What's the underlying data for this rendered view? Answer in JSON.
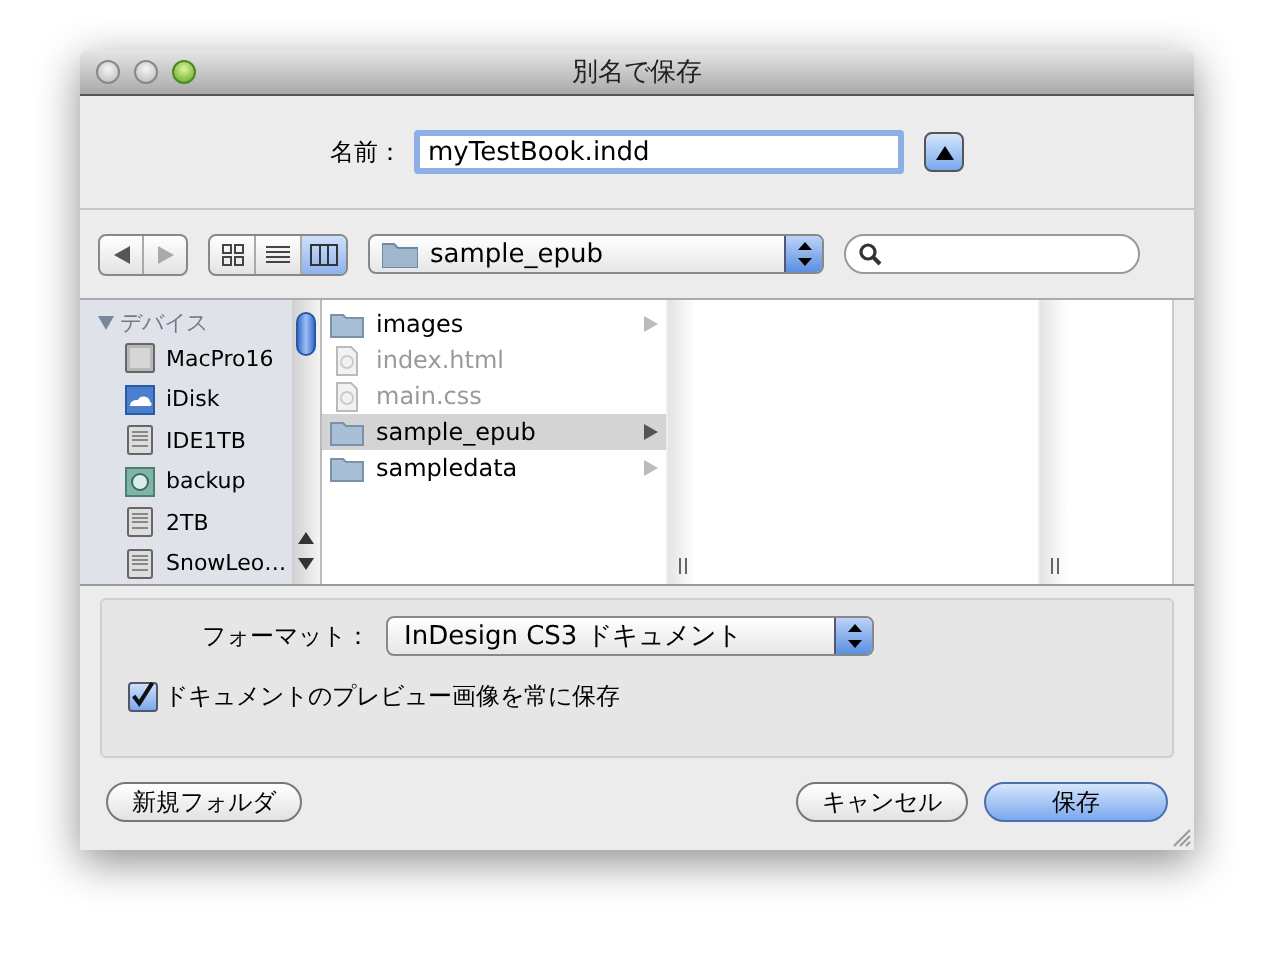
{
  "window": {
    "title": "別名で保存"
  },
  "name_field": {
    "label": "名前：",
    "value": "myTestBook.indd"
  },
  "view_modes": [
    {
      "kind": "icons",
      "selected": false
    },
    {
      "kind": "list",
      "selected": false
    },
    {
      "kind": "columns",
      "selected": true
    }
  ],
  "location": {
    "value": "sample_epub"
  },
  "sidebar": {
    "heading": "デバイス",
    "expanded": true,
    "items": [
      {
        "label": "MacPro16",
        "kind": "computer"
      },
      {
        "label": "iDisk",
        "kind": "idisk"
      },
      {
        "label": "IDE1TB",
        "kind": "disk"
      },
      {
        "label": "backup",
        "kind": "backup"
      },
      {
        "label": "2TB",
        "kind": "disk"
      },
      {
        "label": "SnowLeo…",
        "kind": "disk"
      }
    ]
  },
  "files": [
    {
      "name": "images",
      "kind": "folder",
      "disabled": false,
      "selected": false
    },
    {
      "name": "index.html",
      "kind": "file",
      "disabled": true,
      "selected": false
    },
    {
      "name": "main.css",
      "kind": "file",
      "disabled": true,
      "selected": false
    },
    {
      "name": "sample_epub",
      "kind": "folder",
      "disabled": false,
      "selected": true
    },
    {
      "name": "sampledata",
      "kind": "folder",
      "disabled": false,
      "selected": false
    }
  ],
  "format": {
    "label": "フォーマット：",
    "value": "InDesign CS3 ドキュメント"
  },
  "preview_option": {
    "label": "ドキュメントのプレビュー画像を常に保存",
    "checked": true
  },
  "buttons": [
    {
      "label": "新規フォルダ",
      "default": false
    },
    {
      "label": "キャンセル",
      "default": false
    },
    {
      "label": "保存",
      "default": true
    }
  ]
}
